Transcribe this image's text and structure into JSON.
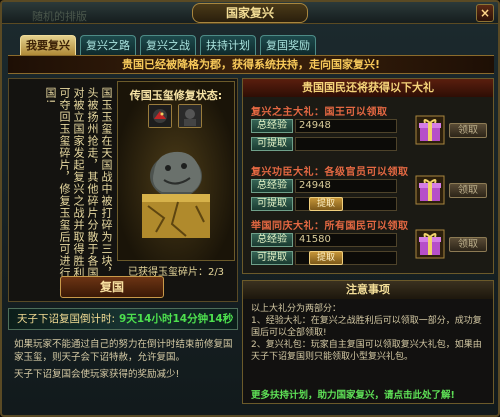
{
  "window": {
    "title": "国家复兴",
    "close_symbol": "×",
    "ghost_text": "随机的排版"
  },
  "tabs": [
    {
      "label": "我要复兴",
      "active": true
    },
    {
      "label": "复兴之路",
      "active": false
    },
    {
      "label": "复兴之战",
      "active": false
    },
    {
      "label": "扶持计划",
      "active": false
    },
    {
      "label": "复国奖励",
      "active": false
    }
  ],
  "banner": "贵国已经被降格为郡，获得系统扶持，走向国家复兴!",
  "story_text": "国玉玉玺在天国战中被打碎为三块，龙头被扬州抢走，其他碎片分散于各国，对被立国家发起复兴之战并取得胜利，可夺回玉玺碎片，修复玉玺后可进行复国!",
  "relic": {
    "title": "传国玉玺修复状态:",
    "fragments_label": "已获得玉玺碎片：",
    "fragments_value": "2/3",
    "slot_icons": [
      "bird-portrait-icon",
      "dark-portrait-icon"
    ]
  },
  "fuguo_button": "复国",
  "countdown": {
    "label": "天子下诏复国倒计时:",
    "value": "9天14小时14分钟14秒"
  },
  "description": [
    "如果玩家不能通过自己的努力在倒计时结束前修复国家玉玺，则天子会下诏特赦，允许复国。",
    "天子下诏复国会使玩家获得的奖励减少!"
  ],
  "rewards": {
    "header": "贵国国民还将获得以下大礼",
    "exp_label": "总经验",
    "get_label": "可提取",
    "claim_small": "提取",
    "claim_label": "领取",
    "items": [
      {
        "title": "复兴之主大礼：国王可以领取",
        "exp": "24948",
        "claim_small_visible": false
      },
      {
        "title": "复兴功臣大礼：各级官员可以领取",
        "exp": "24948",
        "claim_small_visible": true
      },
      {
        "title": "举国同庆大礼：所有国民可以领取",
        "exp": "41580",
        "claim_small_visible": true
      }
    ],
    "gift_icon": "gift-box-icon"
  },
  "notes": {
    "header": "注意事项",
    "lines": [
      "以上大礼分为两部分：",
      "1、经验大礼：在复兴之战胜利后可以领取一部分，成功复国后可以全部领取!",
      "2、复兴礼包：玩家自主复国可以领取复兴大礼包，如果由天子下诏复国则只能领取小型复兴礼包。"
    ],
    "link": "更多扶持计划，助力国家复兴，请点击此处了解!"
  },
  "colors": {
    "accent_gold": "#f7c95a",
    "countdown_green": "#4de04e",
    "reward_title_red": "#e46842",
    "link_green": "#5ee056"
  }
}
